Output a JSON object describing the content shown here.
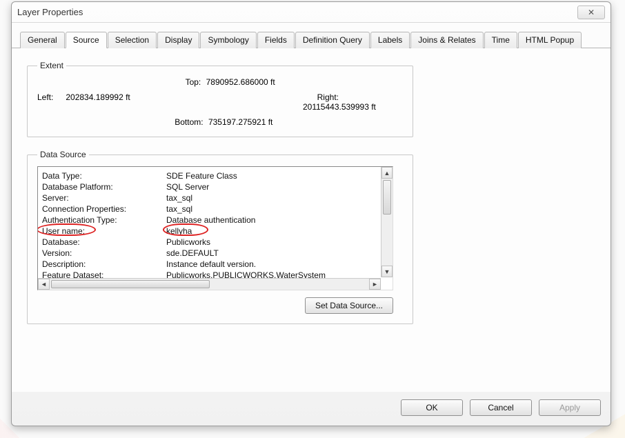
{
  "window": {
    "title": "Layer Properties"
  },
  "tabs": [
    {
      "label": "General"
    },
    {
      "label": "Source"
    },
    {
      "label": "Selection"
    },
    {
      "label": "Display"
    },
    {
      "label": "Symbology"
    },
    {
      "label": "Fields"
    },
    {
      "label": "Definition Query"
    },
    {
      "label": "Labels"
    },
    {
      "label": "Joins & Relates"
    },
    {
      "label": "Time"
    },
    {
      "label": "HTML Popup"
    }
  ],
  "active_tab": 1,
  "extent": {
    "legend": "Extent",
    "top_label": "Top:",
    "top_value": "7890952.686000 ft",
    "left_label": "Left:",
    "left_value": "202834.189992 ft",
    "right_label": "Right:",
    "right_value": "20115443.539993 ft",
    "bottom_label": "Bottom:",
    "bottom_value": "735197.275921 ft"
  },
  "data_source": {
    "legend": "Data Source",
    "rows": [
      {
        "label": "Data Type:",
        "value": "SDE Feature Class"
      },
      {
        "label": "Database Platform:",
        "value": "SQL Server"
      },
      {
        "label": "Server:",
        "value": "tax_sql"
      },
      {
        "label": "Connection Properties:",
        "value": "tax_sql"
      },
      {
        "label": "Authentication Type:",
        "value": "Database authentication"
      },
      {
        "label": "User name:",
        "value": "kellyha"
      },
      {
        "label": "Database:",
        "value": "Publicworks"
      },
      {
        "label": "Version:",
        "value": "sde.DEFAULT"
      },
      {
        "label": "Description:",
        "value": "Instance default version."
      },
      {
        "label": "Feature Dataset:",
        "value": "Publicworks.PUBLICWORKS.WaterSystem"
      }
    ],
    "set_button": "Set Data Source..."
  },
  "footer": {
    "ok": "OK",
    "cancel": "Cancel",
    "apply": "Apply"
  }
}
